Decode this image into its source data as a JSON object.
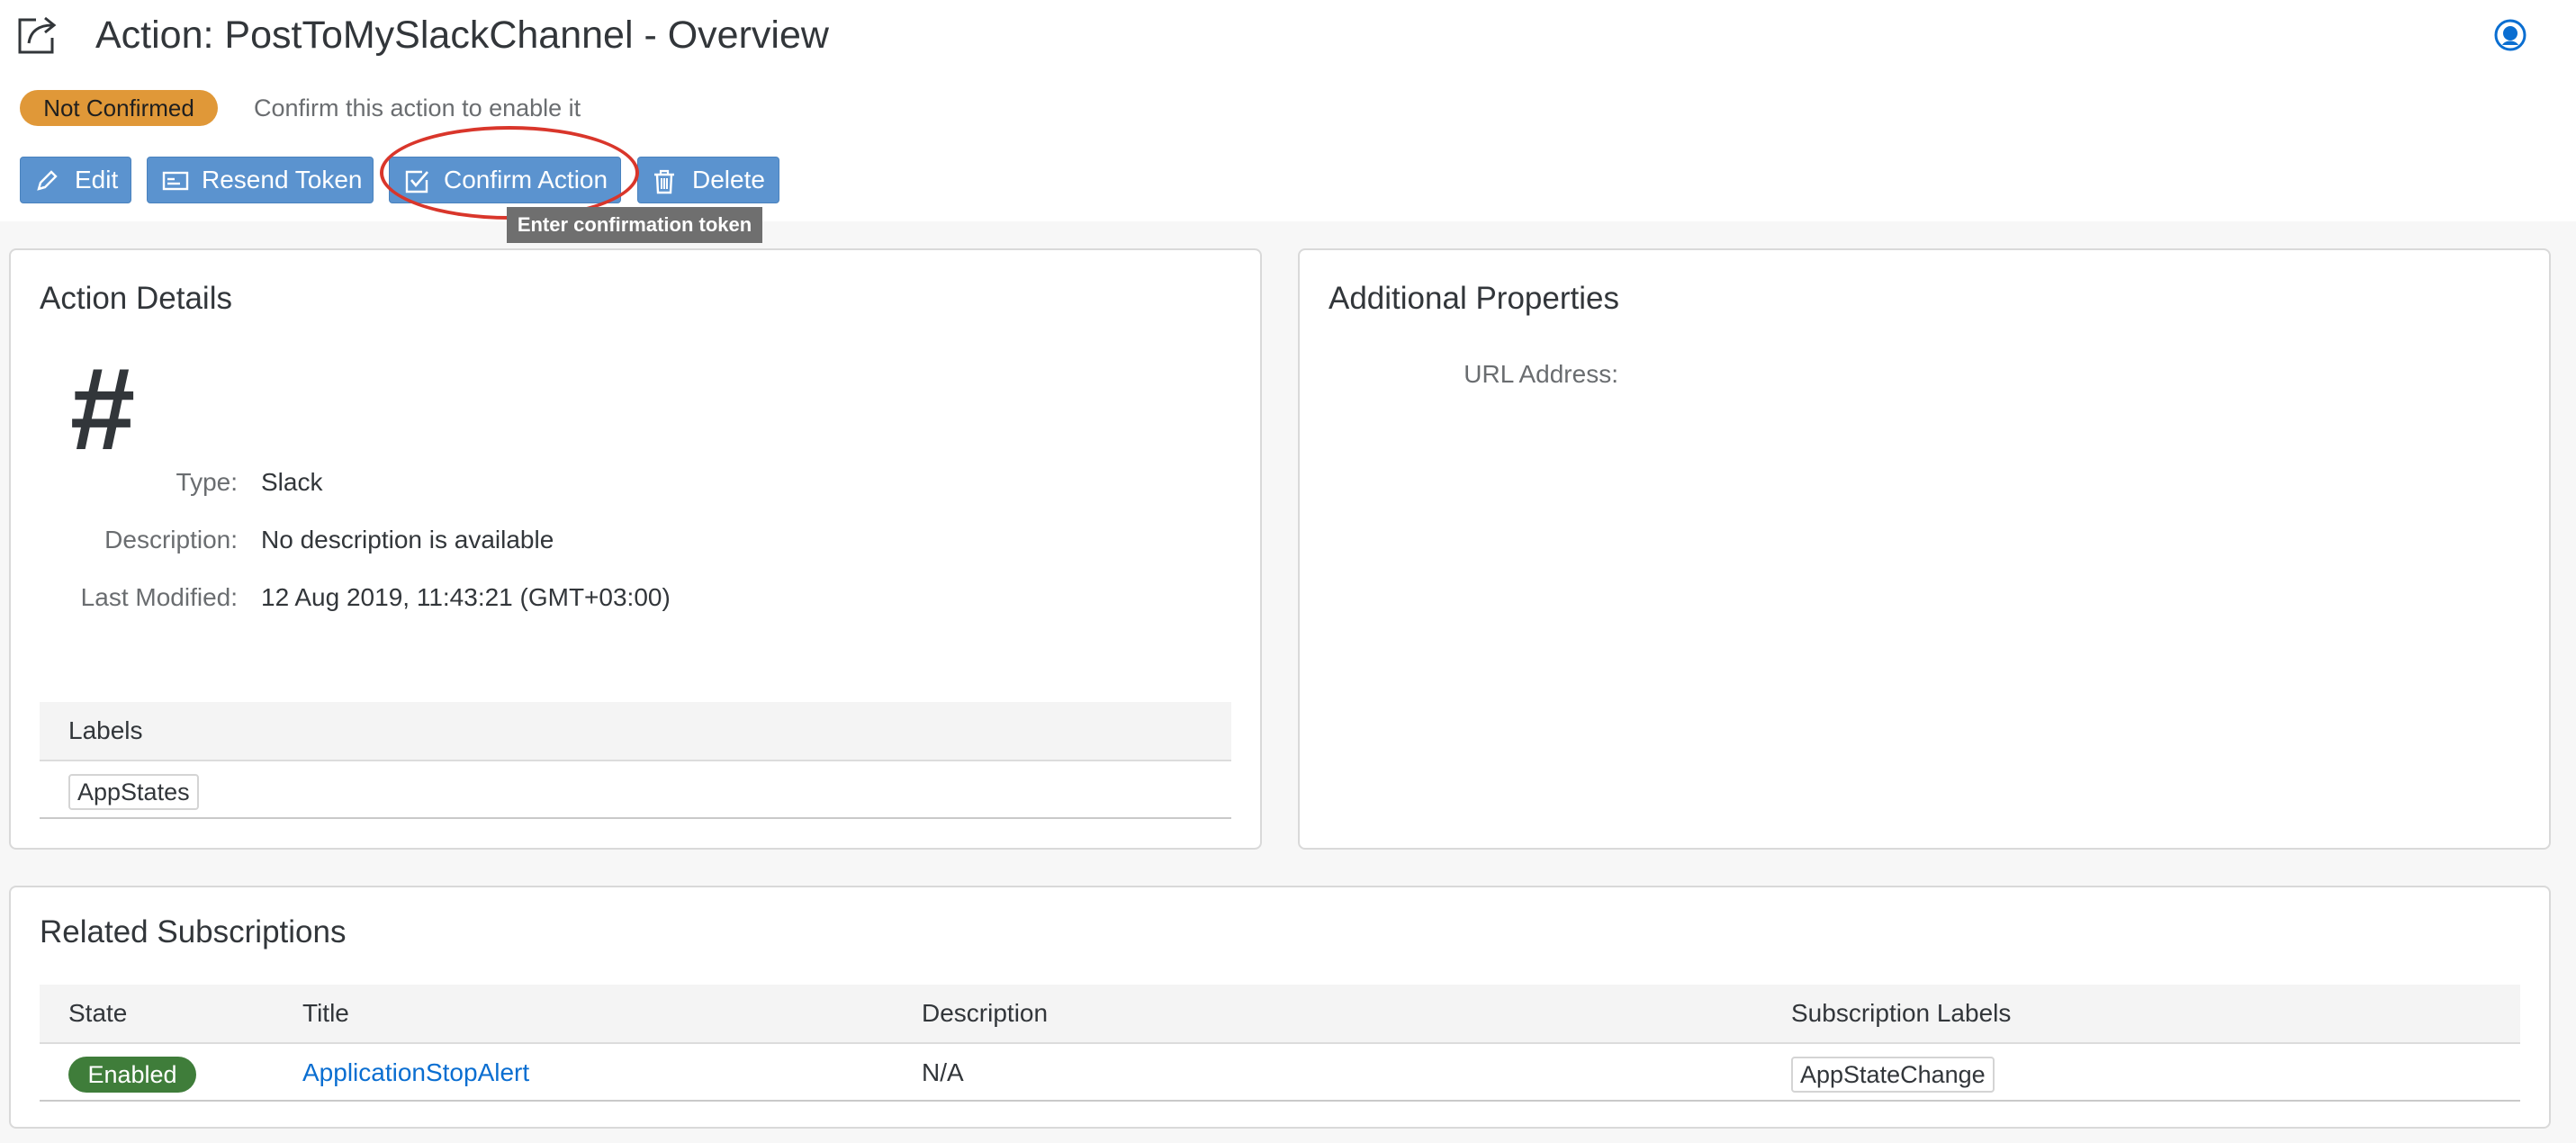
{
  "header": {
    "title": "Action: PostToMySlackChannel - Overview",
    "status": "Not Confirmed",
    "status_hint": "Confirm this action to enable it",
    "toolbar": {
      "edit": "Edit",
      "resend_token": "Resend Token",
      "confirm_action": "Confirm Action",
      "delete": "Delete"
    },
    "tooltip": "Enter confirmation token"
  },
  "action_details": {
    "title": "Action Details",
    "icon": "hash-icon",
    "type_label": "Type:",
    "type_value": "Slack",
    "description_label": "Description:",
    "description_value": "No description is available",
    "last_modified_label": "Last Modified:",
    "last_modified_value": "12 Aug 2019, 11:43:21 (GMT+03:00)",
    "labels_header": "Labels",
    "labels": [
      "AppStates"
    ]
  },
  "additional_properties": {
    "title": "Additional Properties",
    "url_label": "URL Address:",
    "url_value": ""
  },
  "related_subscriptions": {
    "title": "Related Subscriptions",
    "columns": [
      "State",
      "Title",
      "Description",
      "Subscription Labels"
    ],
    "rows": [
      {
        "state": "Enabled",
        "title": "ApplicationStopAlert",
        "description": "N/A",
        "labels": "AppStateChange"
      }
    ]
  },
  "colors": {
    "button": "#5b93cf",
    "warning_badge": "#e09838",
    "success_badge": "#3f7d3a",
    "link": "#0a6ed1",
    "annotation": "#d9362b"
  }
}
